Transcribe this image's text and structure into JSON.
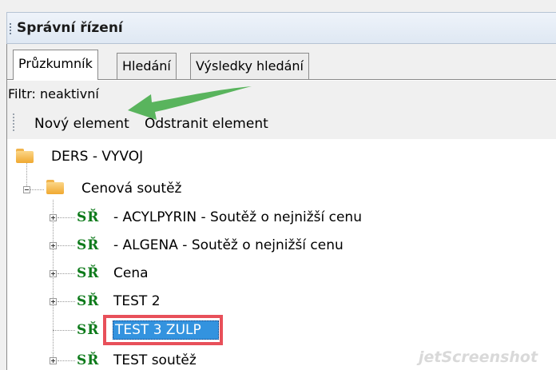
{
  "panel": {
    "title": "Správní řízení"
  },
  "tabs": [
    {
      "label": "Průzkumník",
      "active": true
    },
    {
      "label": "Hledání",
      "active": false
    },
    {
      "label": "Výsledky hledání",
      "active": false
    }
  ],
  "filter": {
    "text": "Filtr: neaktivní"
  },
  "toolbar": {
    "new_label": "Nový element",
    "delete_label": "Odstranit element"
  },
  "tree": {
    "root": {
      "label": "DERS - VYVOJ",
      "icon": "folder-icon"
    },
    "group": {
      "label": "Cenová soutěž",
      "icon": "folder-icon",
      "expanded": true
    },
    "badge": "SŘ",
    "items": [
      {
        "label": " - ACYLPYRIN - Soutěž o nejnižší cenu",
        "expandable": true
      },
      {
        "label": " - ALGENA - Soutěž o nejnižší cenu",
        "expandable": true
      },
      {
        "label": "Cena",
        "expandable": true
      },
      {
        "label": "TEST 2",
        "expandable": true
      },
      {
        "label": "TEST 3 ZULP",
        "expandable": false,
        "selected": true
      },
      {
        "label": "TEST soutěž",
        "expandable": true
      }
    ]
  },
  "annotation": {
    "arrow_color": "#4caf50",
    "highlight_color": "#e8505a"
  },
  "watermark": "jetScreenshot"
}
